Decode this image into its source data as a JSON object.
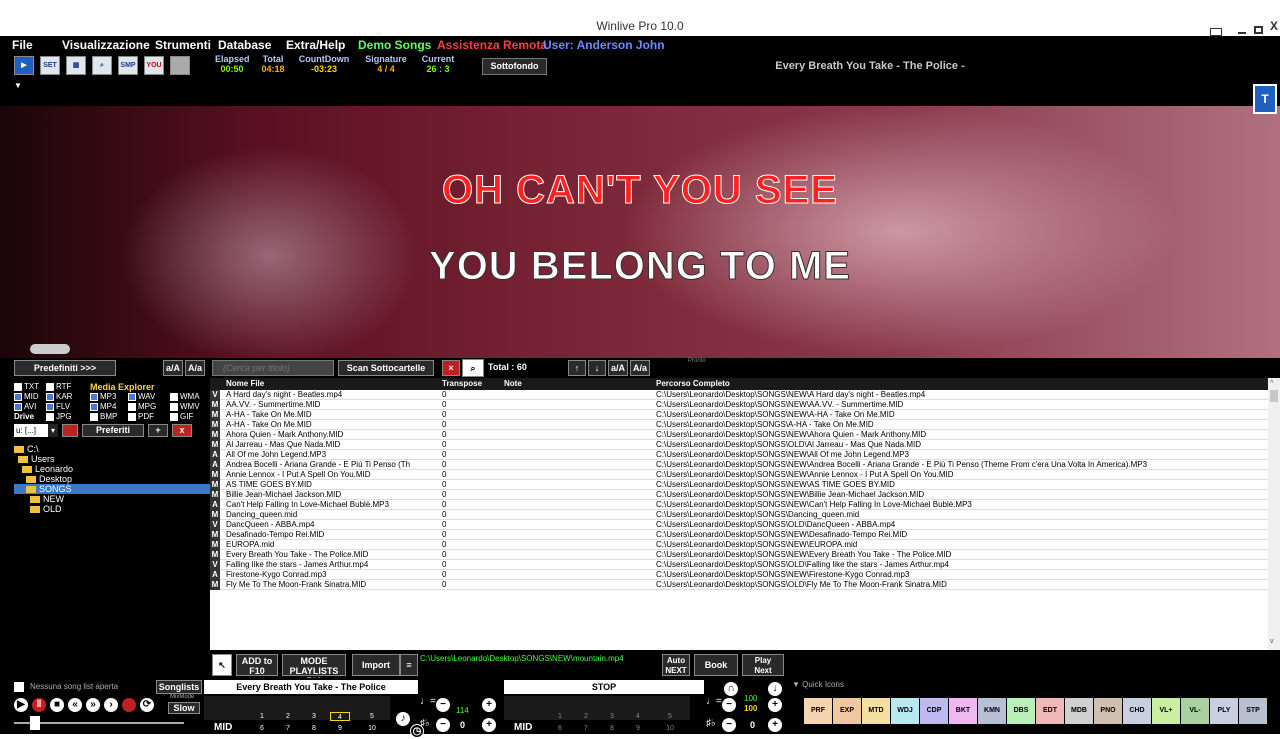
{
  "window": {
    "title": "Winlive Pro 10.0"
  },
  "menu": {
    "file": "File",
    "view": "Visualizzazione",
    "tools": "Strumenti",
    "database": "Database",
    "extra": "Extra/Help",
    "demo": "Demo Songs",
    "remote": "Assistenza Remota",
    "user": "User: Anderson John"
  },
  "toolbar": {
    "icons": [
      "SET",
      "SMP",
      "YOU"
    ],
    "elapsed_label": "Elapsed",
    "elapsed": "00:50",
    "total_label": "Total",
    "total": "04:18",
    "countdown_label": "CountDown",
    "countdown": "-03:23",
    "signature_label": "Signature",
    "signature": "4 / 4",
    "current_label": "Current",
    "current": "26 : 3",
    "sottofondo": "Sottofondo",
    "now_playing": "Every Breath You Take - The Police -"
  },
  "lyrics": {
    "line1": "OH CAN'T YOU SEE",
    "line2": "YOU BELONG TO ME",
    "t_button": "T"
  },
  "left": {
    "predefiniti": "Predefiniti >>>",
    "aa1": "a/A",
    "aa2": "A/a",
    "media_explorer": "Media Explorer",
    "ext": [
      "TXT",
      "RTF",
      "MID",
      "KAR",
      "MP3",
      "WAV",
      "WMA",
      "AVI",
      "FLV",
      "MP4",
      "MPG",
      "WMV",
      "JPG",
      "BMP",
      "PDF",
      "GIF"
    ],
    "drive_label": "Drive",
    "drive_value": "u: [...]",
    "preferiti": "Preferiti",
    "plus": "+",
    "x": "x",
    "tree": [
      "C:\\",
      "Users",
      "Leonardo",
      "Desktop",
      "SONGS",
      "NEW",
      "OLD"
    ]
  },
  "center": {
    "search_placeholder": "(Cerca per titolo)",
    "scan": "Scan Sottocartelle",
    "total": "Total : 60",
    "aa1": "a/A",
    "aa2": "A/a",
    "pronto": "Pronto"
  },
  "grid": {
    "headers": [
      "Nome File",
      "Transpose",
      "Note",
      "Percorso Completo"
    ],
    "rows": [
      [
        "V",
        "A Hard day's night - Beatles.mp4",
        "0",
        "",
        "C:\\Users\\Leonardo\\Desktop\\SONGS\\NEW\\A Hard day's night - Beatles.mp4"
      ],
      [
        "M",
        "AA.VV. - Summertime.MID",
        "0",
        "",
        "C:\\Users\\Leonardo\\Desktop\\SONGS\\NEW\\AA.VV. - Summertime.MID"
      ],
      [
        "M",
        "A-HA - Take On Me.MID",
        "0",
        "",
        "C:\\Users\\Leonardo\\Desktop\\SONGS\\NEW\\A-HA - Take On Me.MID"
      ],
      [
        "M",
        "A-HA - Take On Me.MID",
        "0",
        "",
        "C:\\Users\\Leonardo\\Desktop\\SONGS\\A-HA - Take On Me.MID"
      ],
      [
        "M",
        "Ahora Quien - Mark Anthony.MID",
        "0",
        "",
        "C:\\Users\\Leonardo\\Desktop\\SONGS\\NEW\\Ahora Quien - Mark Anthony.MID"
      ],
      [
        "M",
        "Al Jarreau - Mas Que Nada.MID",
        "0",
        "",
        "C:\\Users\\Leonardo\\Desktop\\SONGS\\OLD\\Al Jarreau - Mas Que Nada.MID"
      ],
      [
        "A",
        "All Of me John Legend.MP3",
        "0",
        "",
        "C:\\Users\\Leonardo\\Desktop\\SONGS\\NEW\\All Of me John Legend.MP3"
      ],
      [
        "A",
        "Andrea Bocelli - Ariana Grande - E Più Ti Penso (Th",
        "0",
        "",
        "C:\\Users\\Leonardo\\Desktop\\SONGS\\NEW\\Andrea Bocelli - Ariana Grande - E Più Ti Penso (Theme From c'era Una Volta In America).MP3"
      ],
      [
        "M",
        "Annie Lennox - I Put A Spell On You.MID",
        "0",
        "",
        "C:\\Users\\Leonardo\\Desktop\\SONGS\\NEW\\Annie Lennox - I Put A Spell On You.MID"
      ],
      [
        "M",
        "AS TIME GOES BY.MID",
        "0",
        "",
        "C:\\Users\\Leonardo\\Desktop\\SONGS\\NEW\\AS TIME GOES BY.MID"
      ],
      [
        "M",
        "Billie Jean-Michael Jackson.MID",
        "0",
        "",
        "C:\\Users\\Leonardo\\Desktop\\SONGS\\NEW\\Billie Jean-Michael Jackson.MID"
      ],
      [
        "A",
        "Can't Help Falling In Love-Michael Bublè.MP3",
        "0",
        "",
        "C:\\Users\\Leonardo\\Desktop\\SONGS\\NEW\\Can't Help Falling In Love-Michael Bublè.MP3"
      ],
      [
        "M",
        "Dancing_queen.mid",
        "0",
        "",
        "C:\\Users\\Leonardo\\Desktop\\SONGS\\Dancing_queen.mid"
      ],
      [
        "V",
        "DancQueen - ABBA.mp4",
        "0",
        "",
        "C:\\Users\\Leonardo\\Desktop\\SONGS\\OLD\\DancQueen - ABBA.mp4"
      ],
      [
        "M",
        "Desafinado-Tempo Rei.MID",
        "0",
        "",
        "C:\\Users\\Leonardo\\Desktop\\SONGS\\NEW\\Desafinado-Tempo Rei.MID"
      ],
      [
        "M",
        "EUROPA.mid",
        "0",
        "",
        "C:\\Users\\Leonardo\\Desktop\\SONGS\\NEW\\EUROPA.mid"
      ],
      [
        "M",
        "Every Breath You Take - The Police.MID",
        "0",
        "",
        "C:\\Users\\Leonardo\\Desktop\\SONGS\\NEW\\Every Breath You Take - The Police.MID"
      ],
      [
        "V",
        "Falling like the stars - James Arthur.mp4",
        "0",
        "",
        "C:\\Users\\Leonardo\\Desktop\\SONGS\\OLD\\Falling like the stars - James Arthur.mp4"
      ],
      [
        "A",
        "Firestone-Kygo Conrad.mp3",
        "0",
        "",
        "C:\\Users\\Leonardo\\Desktop\\SONGS\\NEW\\Firestone-Kygo Conrad.mp3"
      ],
      [
        "M",
        "Fly Me To The Moon-Frank Sinatra.MID",
        "0",
        "",
        "C:\\Users\\Leonardo\\Desktop\\SONGS\\OLD\\Fly Me To The Moon-Frank Sinatra.MID"
      ]
    ]
  },
  "bottombar": {
    "add": "ADD to",
    "add_key": "F10",
    "mode": "MODE",
    "mode_sub": "PLAYLISTS F10",
    "import": "Import",
    "path": "C:\\Users\\Leonardo\\Desktop\\SONGS\\NEW\\mountain.mp4",
    "auto": "Auto",
    "next": "NEXT",
    "book": "Book",
    "play_next": "Play",
    "play_next2": "Next"
  },
  "player": {
    "no_songlist": "Nessuna song list aperta",
    "songlists": "Songlists",
    "mixmode": "MixMode",
    "slow": "Slow",
    "deck1_title": "Every Breath You Take - The Police",
    "deck2_title": "STOP",
    "deck1_type": "MID",
    "deck2_type": "MID",
    "deck1_tempo": "114",
    "deck1_transpose": "0",
    "deck2_transpose": "0",
    "vol1": "100",
    "vol2": "100",
    "vol3": "0",
    "numbers": [
      "1",
      "2",
      "3",
      "4",
      "5",
      "6",
      "7",
      "8",
      "9",
      "10"
    ]
  },
  "quick": {
    "title": "Quick Icons",
    "items": [
      {
        "label": "PRF",
        "color": "#f5d5b0"
      },
      {
        "label": "EXP",
        "color": "#f0c8a0"
      },
      {
        "label": "MTD",
        "color": "#f5e0a0"
      },
      {
        "label": "WDJ",
        "color": "#b8e8f0"
      },
      {
        "label": "CDP",
        "color": "#c0b8f0"
      },
      {
        "label": "BKT",
        "color": "#f0b8f0"
      },
      {
        "label": "KMN",
        "color": "#b8c0d8"
      },
      {
        "label": "DBS",
        "color": "#b8f0b8"
      },
      {
        "label": "EDT",
        "color": "#f0b8b8"
      },
      {
        "label": "MDB",
        "color": "#d0d0d0"
      },
      {
        "label": "PNO",
        "color": "#d0c0b0"
      },
      {
        "label": "CHD",
        "color": "#c8d0e0"
      },
      {
        "label": "VL+",
        "color": "#c8f0a0"
      },
      {
        "label": "VL-",
        "color": "#a8d0a0"
      },
      {
        "label": "PLY",
        "color": "#c8d0e0"
      },
      {
        "label": "STP",
        "color": "#b8c0d0"
      }
    ]
  }
}
